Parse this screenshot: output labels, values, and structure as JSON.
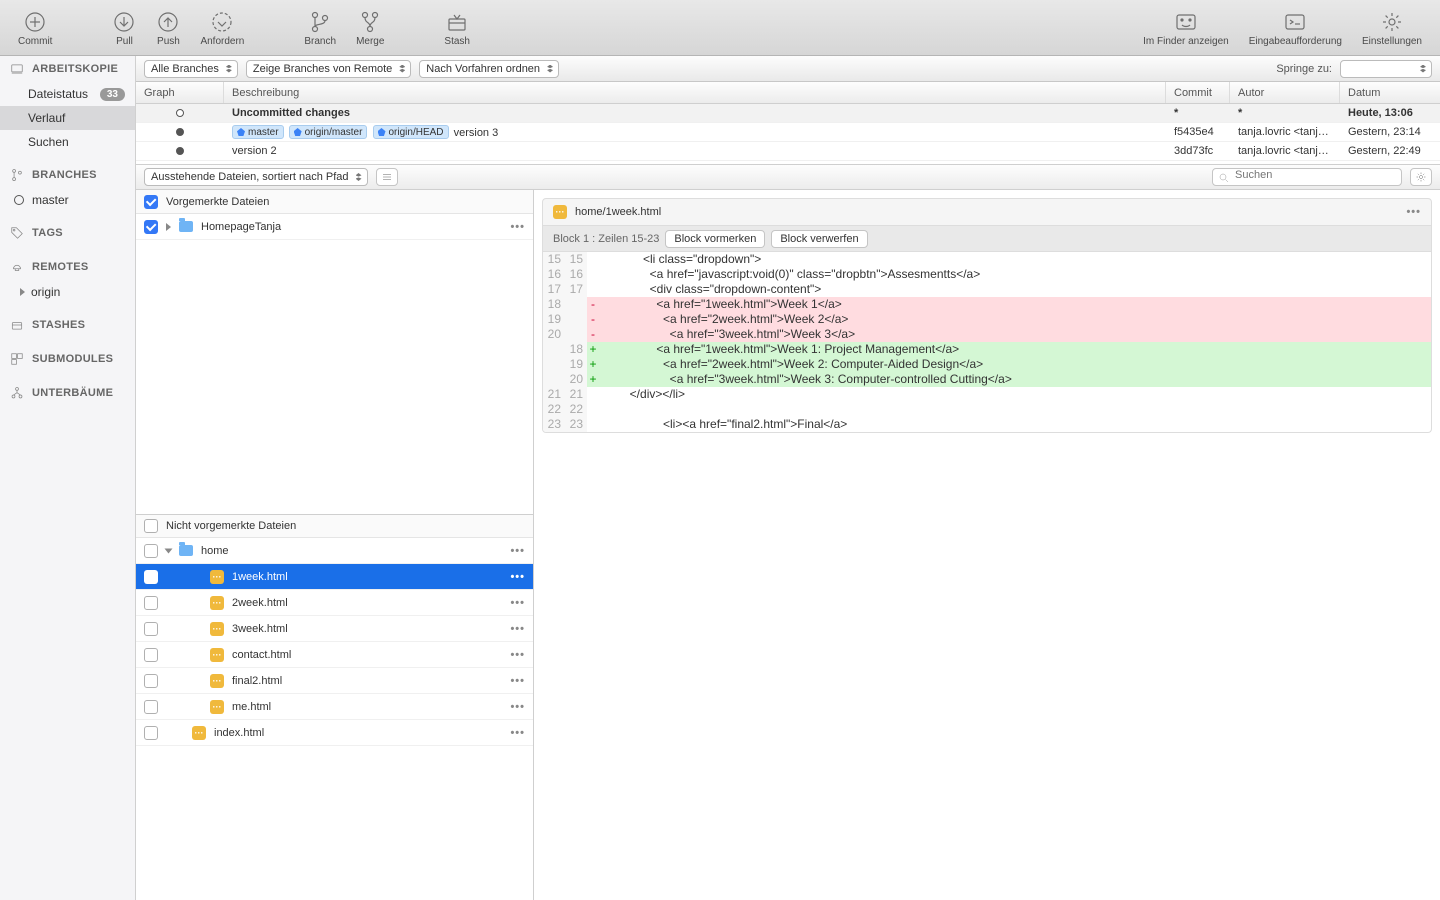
{
  "toolbar": {
    "commit": "Commit",
    "pull": "Pull",
    "push": "Push",
    "fetch": "Anfordern",
    "branch": "Branch",
    "merge": "Merge",
    "stash": "Stash",
    "finder": "Im Finder anzeigen",
    "terminal": "Eingabeaufforderung",
    "settings": "Einstellungen"
  },
  "sidebar": {
    "workingcopy": "ARBEITSKOPIE",
    "filestatus": "Dateistatus",
    "filestatus_badge": "33",
    "history": "Verlauf",
    "search": "Suchen",
    "branches": "BRANCHES",
    "master": "master",
    "tags": "TAGS",
    "remotes": "REMOTES",
    "origin": "origin",
    "stashes": "STASHES",
    "submodules": "SUBMODULES",
    "subtrees": "UNTERBÄUME"
  },
  "filter": {
    "all_branches": "Alle Branches",
    "show_remote": "Zeige Branches von Remote",
    "ancestor": "Nach Vorfahren ordnen",
    "jump": "Springe zu:"
  },
  "history": {
    "h_graph": "Graph",
    "h_desc": "Beschreibung",
    "h_commit": "Commit",
    "h_author": "Autor",
    "h_date": "Datum",
    "r0_desc": "Uncommitted changes",
    "r0_commit": "*",
    "r0_author": "*",
    "r0_date": "Heute, 13:06",
    "r1_tag1": "master",
    "r1_tag2": "origin/master",
    "r1_tag3": "origin/HEAD",
    "r1_desc": "version 3",
    "r1_commit": "f5435e4",
    "r1_author": "tanja.lovric <tanja...",
    "r1_date": "Gestern, 23:14",
    "r2_desc": "version 2",
    "r2_commit": "3dd73fc",
    "r2_author": "tanja.lovric <tanja...",
    "r2_date": "Gestern, 22:49"
  },
  "filebar": {
    "sort": "Ausstehende Dateien, sortiert nach Pfad",
    "search_ph": "Suchen"
  },
  "files": {
    "staged_label": "Vorgemerkte Dateien",
    "staged0": "HomepageTanja",
    "unstaged_label": "Nicht vorgemerkte Dateien",
    "u0": "home",
    "u1": "1week.html",
    "u2": "2week.html",
    "u3": "3week.html",
    "u4": "contact.html",
    "u5": "final2.html",
    "u6": "me.html",
    "u7": "index.html"
  },
  "diff": {
    "file": "home/1week.html",
    "hunk": "Block 1 : Zeilen 15-23",
    "btn_stage": "Block vormerken",
    "btn_discard": "Block verwerfen",
    "l15": "            <li class=\"dropdown\">",
    "l16": "              <a href=\"javascript:void(0)\" class=\"dropbtn\">Assesmentts</a>",
    "l17": "              <div class=\"dropdown-content\">",
    "l18d": "                <a href=\"1week.html\">Week 1</a>",
    "l19d": "                  <a href=\"2week.html\">Week 2</a>",
    "l20d": "                    <a href=\"3week.html\">Week 3</a>",
    "l18a": "                <a href=\"1week.html\">Week 1: Project Management</a>",
    "l19a": "                  <a href=\"2week.html\">Week 2: Computer-Aided Design</a>",
    "l20a": "                    <a href=\"3week.html\">Week 3: Computer-controlled Cutting</a>",
    "l21": "        </div></li>",
    "l22": "",
    "l23": "                  <li><a href=\"final2.html\">Final</a>"
  }
}
